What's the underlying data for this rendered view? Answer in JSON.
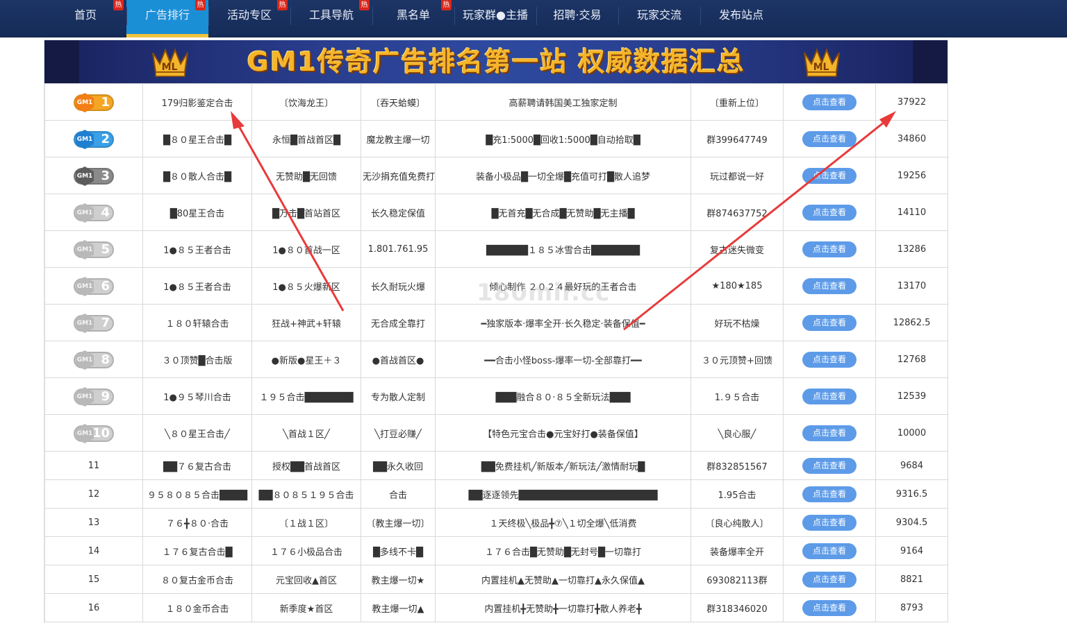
{
  "nav": {
    "items": [
      {
        "label": "首页",
        "hot": true
      },
      {
        "label": "广告排行",
        "hot": true,
        "active": true
      },
      {
        "label": "活动专区",
        "hot": true
      },
      {
        "label": "工具导航",
        "hot": true
      },
      {
        "label": "黑名单",
        "hot": true
      },
      {
        "label": "玩家群●主播",
        "hot": false
      },
      {
        "label": "招聘·交易",
        "hot": false
      },
      {
        "label": "玩家交流",
        "hot": false
      },
      {
        "label": "发布站点",
        "hot": false
      }
    ],
    "hot_label": "热"
  },
  "banner": {
    "title": "GM1传奇广告排名第一站   权威数据汇总",
    "logo_text": "ML"
  },
  "watermark": "180mir.cc",
  "gm_label": "GM1",
  "view_label": "点击查看",
  "rows": [
    {
      "rank": "1",
      "name": "179归影鉴定合击",
      "c2": "〔饮海龙王〕",
      "c3": "〔吞天蛤蟆〕",
      "desc": "高薪聘请韩国美工独家定制",
      "note": "〔重新上位〕",
      "score": "37922"
    },
    {
      "rank": "2",
      "name": "█８０星王合击█",
      "c2": "永恒█首战首区█",
      "c3": "魔龙教主爆一切",
      "desc": "█充1:5000█回收1:5000█自动拾取█",
      "note": "群399647749",
      "score": "34860"
    },
    {
      "rank": "3",
      "name": "█８０散人合击█",
      "c2": "无赞助█无回馈",
      "c3": "无沙捐充值免费打",
      "desc": "装备小极品█一切全爆█充值可打█散人追梦",
      "note": "玩过都说一好",
      "score": "19256"
    },
    {
      "rank": "4",
      "name": "█80星王合击",
      "c2": "█万击█首站首区",
      "c3": "长久稳定保值",
      "desc": "█无首充█无合成█无赞助█无主播█",
      "note": "群874637752",
      "score": "14110"
    },
    {
      "rank": "5",
      "name": "1●８５王者合击",
      "c2": "1●８０首战一区",
      "c3": "1.801.761.95",
      "desc": "██████１８５冰雪合击███████",
      "note": "复古迷失微变",
      "score": "13286"
    },
    {
      "rank": "6",
      "name": "1●８５王者合击",
      "c2": "1●８５火爆新区",
      "c3": "长久耐玩火爆",
      "desc": "倾心制作 ２０２４最好玩的王者合击",
      "note": "★180★185",
      "score": "13170"
    },
    {
      "rank": "7",
      "name": "１８０轩辕合击",
      "c2": "狂战+神武+轩辕",
      "c3": "无合成全靠打",
      "desc": "━独家版本·爆率全开·长久稳定·装备保值━",
      "note": "好玩不枯燥",
      "score": "12862.5"
    },
    {
      "rank": "8",
      "name": "３０顶赞█合击版",
      "c2": "●新版●星王＋３",
      "c3": "●首战首区●",
      "desc": "━━合击小怪boss-爆率一切-全部靠打━━",
      "note": "３０元顶赞+回馈",
      "score": "12768"
    },
    {
      "rank": "9",
      "name": "1●９５琴川合击",
      "c2": "１９５合击███████",
      "c3": "专为散人定制",
      "desc": "███融合８０·８５全新玩法███",
      "note": "1.９５合击",
      "score": "12539"
    },
    {
      "rank": "10",
      "name": "╲８０星王合击╱",
      "c2": "╲首战１区╱",
      "c3": "╲打豆必赚╱",
      "desc": "【特色元宝合击●元宝好打●装备保值】",
      "note": "╲良心服╱",
      "score": "10000"
    },
    {
      "rank": "11",
      "name": "██７６复古合击",
      "c2": "授权██首战首区",
      "c3": "██永久收回",
      "desc": "██免费挂机╱新版本╱新玩法╱激情耐玩█",
      "note": "群832851567",
      "score": "9684"
    },
    {
      "rank": "12",
      "name": "９５８０８５合击████",
      "c2": "██８０８５１９５合击",
      "c3": "合击",
      "desc": "██逐逐领先████████████████████",
      "note": "1.95合击",
      "score": "9316.5"
    },
    {
      "rank": "13",
      "name": "７６╋８０·合击",
      "c2": "〔１战１区〕",
      "c3": "〔教主爆一切〕",
      "desc": "１天终极╲极品╋⑦╲１切全爆╲低消费",
      "note": "〔良心纯散人〕",
      "score": "9304.5"
    },
    {
      "rank": "14",
      "name": "１７６复古合击█",
      "c2": "１７６小极品合击",
      "c3": "█多线不卡█",
      "desc": "１７６合击█无赞助█无封号█一切靠打",
      "note": "装备爆率全开",
      "score": "9164"
    },
    {
      "rank": "15",
      "name": "８０复古金币合击",
      "c2": "元宝回收▲首区",
      "c3": "教主爆一切★",
      "desc": "内置挂机▲无赞助▲一切靠打▲永久保值▲",
      "note": "693082113群",
      "score": "8821"
    },
    {
      "rank": "16",
      "name": "１８０金币合击",
      "c2": "新季度★首区",
      "c3": "教主爆一切▲",
      "desc": "内置挂机╋无赞助╋一切靠打╋散人养老╋",
      "note": "群318346020",
      "score": "8793"
    }
  ],
  "colors": {
    "nav_bg": "#1a3160",
    "nav_active": "#1b8fd6",
    "button": "#5d9be8",
    "arrow": "#e83a3a",
    "rank1": "#f5a623",
    "rank2": "#3aa0e8",
    "rank3": "#8a8a8a"
  }
}
